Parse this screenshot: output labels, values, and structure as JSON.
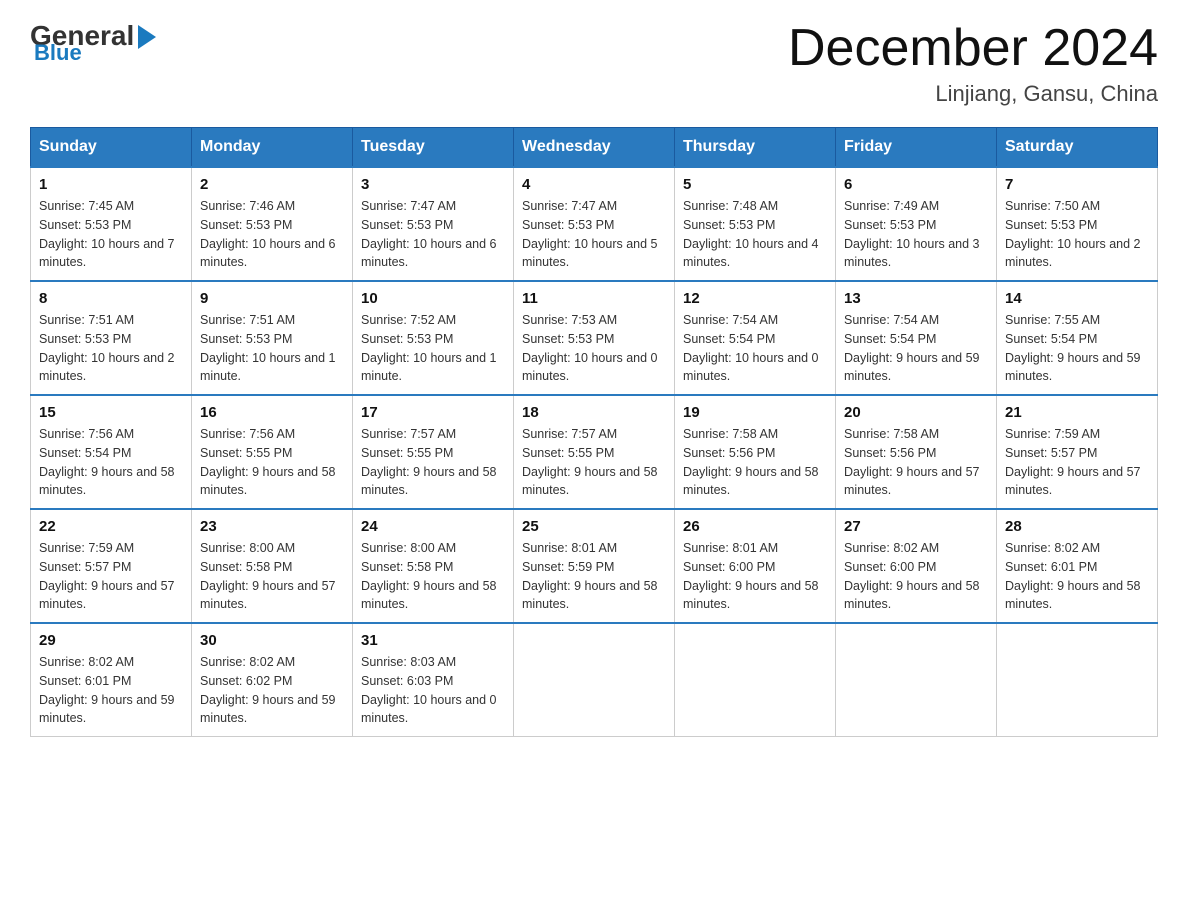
{
  "header": {
    "logo": {
      "general": "General",
      "blue": "Blue"
    },
    "title": "December 2024",
    "location": "Linjiang, Gansu, China"
  },
  "weekdays": [
    "Sunday",
    "Monday",
    "Tuesday",
    "Wednesday",
    "Thursday",
    "Friday",
    "Saturday"
  ],
  "weeks": [
    [
      {
        "day": "1",
        "sunrise": "7:45 AM",
        "sunset": "5:53 PM",
        "daylight": "10 hours and 7 minutes."
      },
      {
        "day": "2",
        "sunrise": "7:46 AM",
        "sunset": "5:53 PM",
        "daylight": "10 hours and 6 minutes."
      },
      {
        "day": "3",
        "sunrise": "7:47 AM",
        "sunset": "5:53 PM",
        "daylight": "10 hours and 6 minutes."
      },
      {
        "day": "4",
        "sunrise": "7:47 AM",
        "sunset": "5:53 PM",
        "daylight": "10 hours and 5 minutes."
      },
      {
        "day": "5",
        "sunrise": "7:48 AM",
        "sunset": "5:53 PM",
        "daylight": "10 hours and 4 minutes."
      },
      {
        "day": "6",
        "sunrise": "7:49 AM",
        "sunset": "5:53 PM",
        "daylight": "10 hours and 3 minutes."
      },
      {
        "day": "7",
        "sunrise": "7:50 AM",
        "sunset": "5:53 PM",
        "daylight": "10 hours and 2 minutes."
      }
    ],
    [
      {
        "day": "8",
        "sunrise": "7:51 AM",
        "sunset": "5:53 PM",
        "daylight": "10 hours and 2 minutes."
      },
      {
        "day": "9",
        "sunrise": "7:51 AM",
        "sunset": "5:53 PM",
        "daylight": "10 hours and 1 minute."
      },
      {
        "day": "10",
        "sunrise": "7:52 AM",
        "sunset": "5:53 PM",
        "daylight": "10 hours and 1 minute."
      },
      {
        "day": "11",
        "sunrise": "7:53 AM",
        "sunset": "5:53 PM",
        "daylight": "10 hours and 0 minutes."
      },
      {
        "day": "12",
        "sunrise": "7:54 AM",
        "sunset": "5:54 PM",
        "daylight": "10 hours and 0 minutes."
      },
      {
        "day": "13",
        "sunrise": "7:54 AM",
        "sunset": "5:54 PM",
        "daylight": "9 hours and 59 minutes."
      },
      {
        "day": "14",
        "sunrise": "7:55 AM",
        "sunset": "5:54 PM",
        "daylight": "9 hours and 59 minutes."
      }
    ],
    [
      {
        "day": "15",
        "sunrise": "7:56 AM",
        "sunset": "5:54 PM",
        "daylight": "9 hours and 58 minutes."
      },
      {
        "day": "16",
        "sunrise": "7:56 AM",
        "sunset": "5:55 PM",
        "daylight": "9 hours and 58 minutes."
      },
      {
        "day": "17",
        "sunrise": "7:57 AM",
        "sunset": "5:55 PM",
        "daylight": "9 hours and 58 minutes."
      },
      {
        "day": "18",
        "sunrise": "7:57 AM",
        "sunset": "5:55 PM",
        "daylight": "9 hours and 58 minutes."
      },
      {
        "day": "19",
        "sunrise": "7:58 AM",
        "sunset": "5:56 PM",
        "daylight": "9 hours and 58 minutes."
      },
      {
        "day": "20",
        "sunrise": "7:58 AM",
        "sunset": "5:56 PM",
        "daylight": "9 hours and 57 minutes."
      },
      {
        "day": "21",
        "sunrise": "7:59 AM",
        "sunset": "5:57 PM",
        "daylight": "9 hours and 57 minutes."
      }
    ],
    [
      {
        "day": "22",
        "sunrise": "7:59 AM",
        "sunset": "5:57 PM",
        "daylight": "9 hours and 57 minutes."
      },
      {
        "day": "23",
        "sunrise": "8:00 AM",
        "sunset": "5:58 PM",
        "daylight": "9 hours and 57 minutes."
      },
      {
        "day": "24",
        "sunrise": "8:00 AM",
        "sunset": "5:58 PM",
        "daylight": "9 hours and 58 minutes."
      },
      {
        "day": "25",
        "sunrise": "8:01 AM",
        "sunset": "5:59 PM",
        "daylight": "9 hours and 58 minutes."
      },
      {
        "day": "26",
        "sunrise": "8:01 AM",
        "sunset": "6:00 PM",
        "daylight": "9 hours and 58 minutes."
      },
      {
        "day": "27",
        "sunrise": "8:02 AM",
        "sunset": "6:00 PM",
        "daylight": "9 hours and 58 minutes."
      },
      {
        "day": "28",
        "sunrise": "8:02 AM",
        "sunset": "6:01 PM",
        "daylight": "9 hours and 58 minutes."
      }
    ],
    [
      {
        "day": "29",
        "sunrise": "8:02 AM",
        "sunset": "6:01 PM",
        "daylight": "9 hours and 59 minutes."
      },
      {
        "day": "30",
        "sunrise": "8:02 AM",
        "sunset": "6:02 PM",
        "daylight": "9 hours and 59 minutes."
      },
      {
        "day": "31",
        "sunrise": "8:03 AM",
        "sunset": "6:03 PM",
        "daylight": "10 hours and 0 minutes."
      },
      null,
      null,
      null,
      null
    ]
  ]
}
